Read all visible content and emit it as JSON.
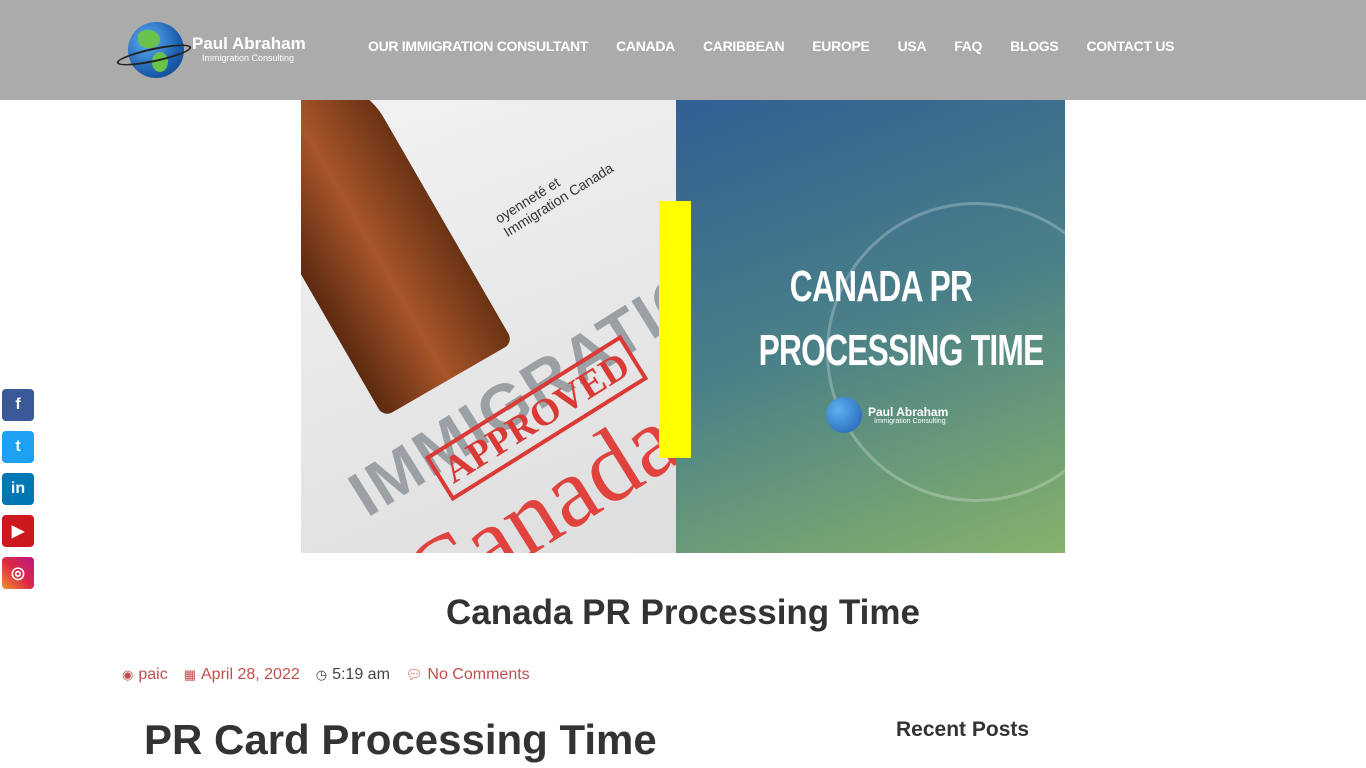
{
  "logo": {
    "name": "Paul Abraham",
    "subtitle": "Immigration Consulting"
  },
  "nav": [
    "OUR IMMIGRATION CONSULTANT",
    "CANADA",
    "CARIBBEAN",
    "EUROPE",
    "USA",
    "FAQ",
    "BLOGS",
    "CONTACT US"
  ],
  "hero": {
    "left_texts": {
      "immigration": "IMMIGRATION",
      "approved": "APPROVED",
      "canada": "Canada",
      "gov": "oyenneté et\nImmigration Canada"
    },
    "title_line1": "CANADA PR",
    "title_line2": "PROCESSING TIME",
    "logo_name": "Paul Abraham",
    "logo_sub": "Immigration Consulting",
    "accent": "#ffff00"
  },
  "social": [
    {
      "icon": "facebook-icon",
      "glyph": "f",
      "color": "#3b5998"
    },
    {
      "icon": "twitter-icon",
      "glyph": "t",
      "color": "#1da1f2"
    },
    {
      "icon": "linkedin-icon",
      "glyph": "in",
      "color": "#0077b5"
    },
    {
      "icon": "youtube-icon",
      "glyph": "▶",
      "color": "#cc181e"
    },
    {
      "icon": "instagram-icon",
      "glyph": "◎",
      "color": "#e1306c"
    }
  ],
  "post": {
    "title": "Canada PR Processing Time",
    "author": "paic",
    "date": "April 28, 2022",
    "time": "5:19 am",
    "comments": "No Comments",
    "heading": "PR Card Processing Time"
  },
  "sidebar": {
    "recent_posts": "Recent Posts"
  }
}
